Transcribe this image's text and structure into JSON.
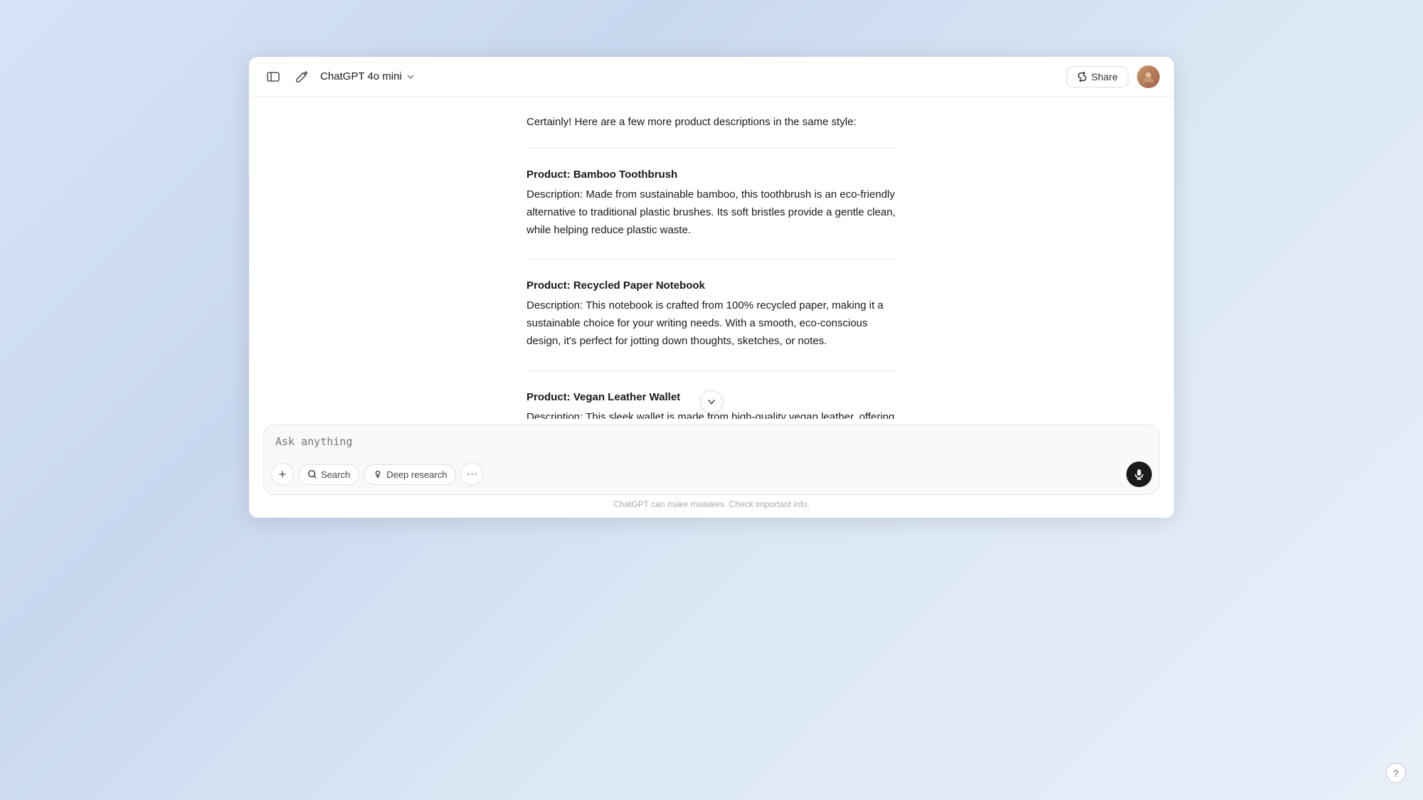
{
  "header": {
    "model_name": "ChatGPT 4o mini",
    "share_label": "Share",
    "chevron": "›"
  },
  "content": {
    "intro": "Certainly! Here are a few more product descriptions in the same style:",
    "products": [
      {
        "title": "Product: Bamboo Toothbrush",
        "description": "Description: Made from sustainable bamboo, this toothbrush is an eco-friendly alternative to traditional plastic brushes. Its soft bristles provide a gentle clean, while helping reduce plastic waste."
      },
      {
        "title": "Product: Recycled Paper Notebook",
        "description": "Description: This notebook is crafted from 100% recycled paper, making it a sustainable choice for your writing needs. With a smooth, eco-conscious design, it's perfect for jotting down thoughts, sketches, or notes."
      },
      {
        "title": "Product: Vegan Leather Wallet",
        "description": "Description: This sleek wallet is made from high-quality vegan leather, offering a cruelty-free alternative to traditional leather. Its minimalist design makes it the perfect accessory for the modern, eco-conscious individual."
      }
    ]
  },
  "input": {
    "placeholder": "Ask anything"
  },
  "toolbar": {
    "add_label": "+",
    "search_label": "Search",
    "deep_research_label": "Deep research",
    "more_label": "···"
  },
  "footer": {
    "disclaimer": "ChatGPT can make mistakes. Check important info."
  },
  "help": {
    "label": "?"
  },
  "icons": {
    "sidebar_icon": "sidebar",
    "edit_icon": "edit",
    "share_icon": "share",
    "globe_icon": "globe",
    "microscope_icon": "microscope",
    "mic_icon": "mic",
    "down_arrow": "↓"
  }
}
